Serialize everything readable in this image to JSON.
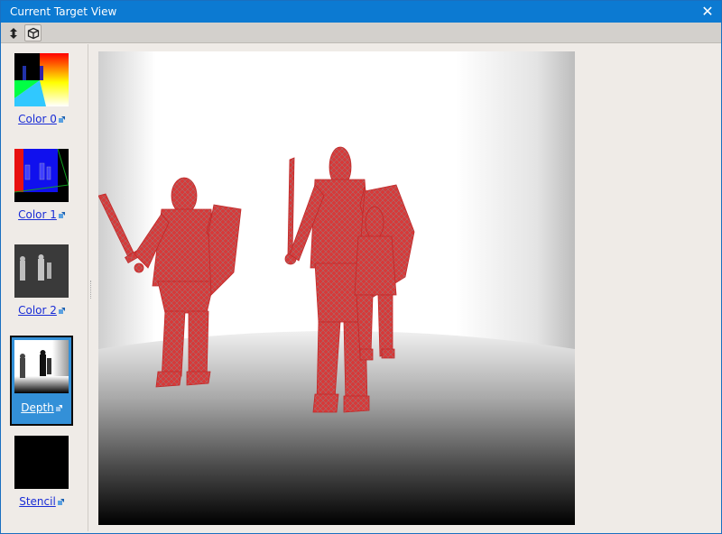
{
  "window": {
    "title": "Current Target View"
  },
  "toolbar": {
    "tools": [
      {
        "icon": "vertical-arrows-icon"
      },
      {
        "icon": "cube-icon"
      }
    ]
  },
  "thumbnails": [
    {
      "label": "Color 0",
      "selected": false
    },
    {
      "label": "Color 1",
      "selected": false
    },
    {
      "label": "Color 2",
      "selected": false
    },
    {
      "label": "Depth",
      "selected": true
    },
    {
      "label": "Stencil",
      "selected": false
    }
  ],
  "colors": {
    "titlebar": "#0c7ad2",
    "selection": "#3390d8",
    "link": "#1a2dd6",
    "mesh": "#d63a3a"
  }
}
